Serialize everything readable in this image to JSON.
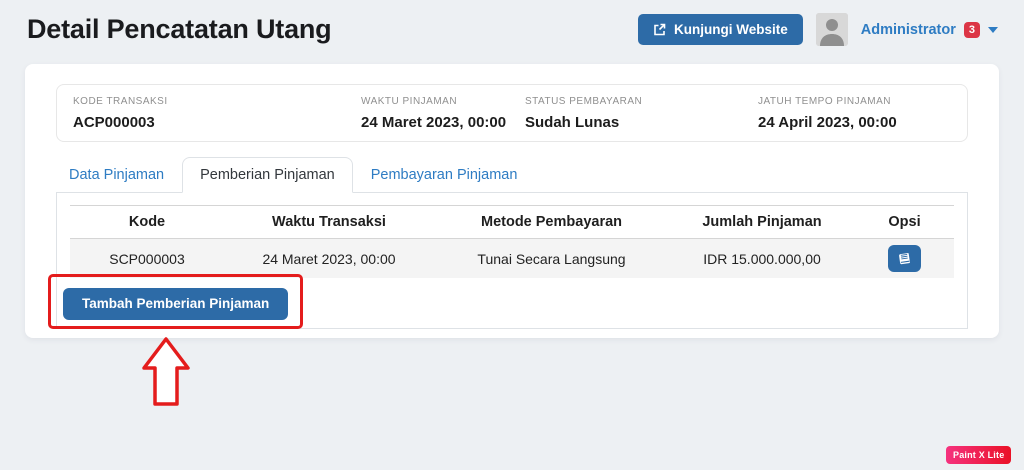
{
  "page": {
    "title": "Detail Pencatatan Utang"
  },
  "header": {
    "visit_website_label": "Kunjungi Website",
    "user_name": "Administrator",
    "notification_count": "3"
  },
  "summary": {
    "fields": [
      {
        "label": "KODE TRANSAKSI",
        "value": "ACP000003"
      },
      {
        "label": "WAKTU PINJAMAN",
        "value": "24 Maret 2023, 00:00"
      },
      {
        "label": "STATUS PEMBAYARAN",
        "value": "Sudah Lunas"
      },
      {
        "label": "JATUH TEMPO PINJAMAN",
        "value": "24 April 2023, 00:00"
      }
    ]
  },
  "tabs": [
    {
      "label": "Data Pinjaman",
      "active": false
    },
    {
      "label": "Pemberian Pinjaman",
      "active": true
    },
    {
      "label": "Pembayaran Pinjaman",
      "active": false
    }
  ],
  "table": {
    "headers": [
      "Kode",
      "Waktu Transaksi",
      "Metode Pembayaran",
      "Jumlah Pinjaman",
      "Opsi"
    ],
    "rows": [
      {
        "kode": "SCP000003",
        "waktu_transaksi": "24 Maret 2023, 00:00",
        "metode_pembayaran": "Tunai Secara Langsung",
        "jumlah_pinjaman": "IDR 15.000.000,00"
      }
    ]
  },
  "actions": {
    "add_button_label": "Tambah Pemberian Pinjaman"
  },
  "watermark": {
    "label": "Paint X Lite"
  },
  "colors": {
    "primary_button": "#2d6ba7",
    "link_blue": "#2e7cc3",
    "danger_badge": "#dc3545",
    "annotation_red": "#e41c1c",
    "page_background": "#edf0f3"
  }
}
